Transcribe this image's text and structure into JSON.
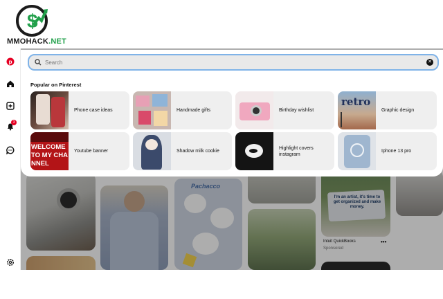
{
  "watermark": {
    "brand_main": "MMOHACK",
    "brand_tld": ".NET"
  },
  "sidebar": {
    "items": [
      {
        "icon": "pinterest-logo-icon"
      },
      {
        "icon": "home-icon"
      },
      {
        "icon": "create-icon"
      },
      {
        "icon": "notifications-icon",
        "badge": "3"
      },
      {
        "icon": "messages-icon"
      },
      {
        "icon": "settings-icon"
      }
    ]
  },
  "search": {
    "placeholder": "Search",
    "value": ""
  },
  "popular": {
    "heading": "Popular on Pinterest",
    "items": [
      {
        "label": "Phone case ideas"
      },
      {
        "label": "Handmade gifts"
      },
      {
        "label": "Birthday wishlist"
      },
      {
        "label": "Graphic design",
        "thumb_text": "retro"
      },
      {
        "label": "Youtube banner",
        "thumb_text": "WELCOME TO MY CHANNEL"
      },
      {
        "label": "Shadow milk cookie"
      },
      {
        "label": "Highlight covers instagram"
      },
      {
        "label": "Iphone 13 pro"
      }
    ]
  },
  "feed": {
    "pachacco_text": "Pachacco",
    "ad_text": "I'm an artist, it's time to get organized and make money.",
    "sponsor_name": "Intuit QuickBooks",
    "sponsor_sub": "Sponsored",
    "more": "•••"
  },
  "colors": {
    "pinterest_red": "#e60023",
    "focus_border": "#7fb3e8",
    "card_bg": "#efefef",
    "brand_green": "#22a04b"
  }
}
